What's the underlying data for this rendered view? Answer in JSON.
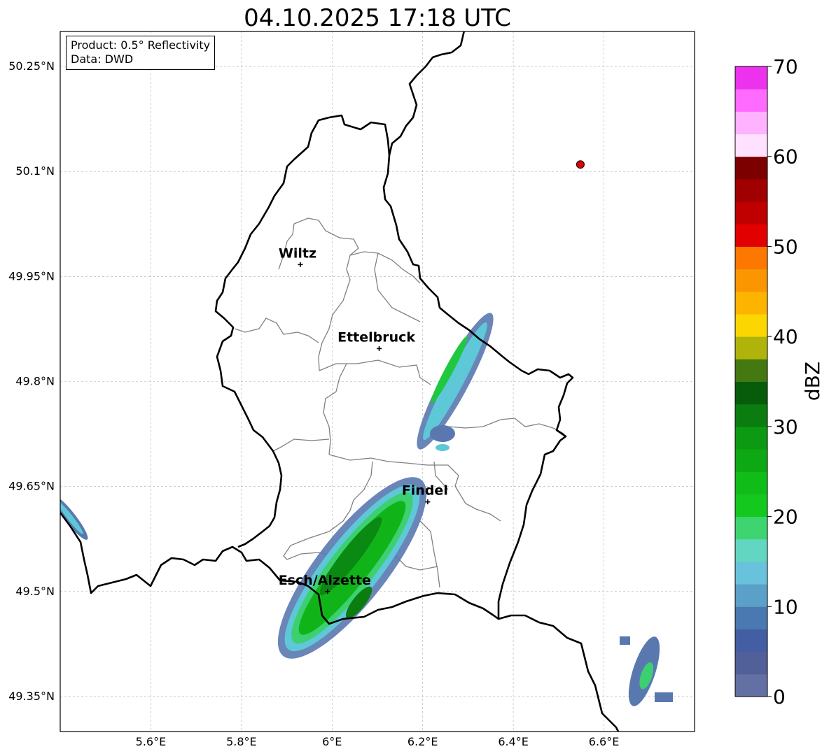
{
  "title": "04.10.2025 17:18 UTC",
  "info_box": {
    "product": "Product: 0.5° Reflectivity",
    "source": "Data: DWD"
  },
  "map": {
    "lon_range": [
      5.4,
      6.8
    ],
    "lat_range": [
      49.3,
      50.3
    ],
    "lon_ticks": [
      {
        "value": 5.6,
        "label": "5.6°E"
      },
      {
        "value": 5.8,
        "label": "5.8°E"
      },
      {
        "value": 6.0,
        "label": "6°E"
      },
      {
        "value": 6.2,
        "label": "6.2°E"
      },
      {
        "value": 6.4,
        "label": "6.4°E"
      },
      {
        "value": 6.6,
        "label": "6.6°E"
      }
    ],
    "lat_ticks": [
      {
        "value": 49.35,
        "label": "49.35°N"
      },
      {
        "value": 49.5,
        "label": "49.5°N"
      },
      {
        "value": 49.65,
        "label": "49.65°N"
      },
      {
        "value": 49.8,
        "label": "49.8°N"
      },
      {
        "value": 49.95,
        "label": "49.95°N"
      },
      {
        "value": 50.1,
        "label": "50.1°N"
      },
      {
        "value": 50.25,
        "label": "50.25°N"
      }
    ],
    "grid": true,
    "cities": [
      {
        "name": "Wiltz",
        "lon": 5.93,
        "lat": 49.967
      },
      {
        "name": "Ettelbruck",
        "lon": 6.104,
        "lat": 49.847
      },
      {
        "name": "Findel",
        "lon": 6.211,
        "lat": 49.628
      },
      {
        "name": "Esch/Alzette",
        "lon": 5.99,
        "lat": 49.5
      }
    ],
    "radar_site": {
      "lon": 6.548,
      "lat": 50.11,
      "color": "#e00000"
    }
  },
  "colorbar": {
    "label": "dBZ",
    "min": 0,
    "max": 70,
    "step": 2.5,
    "tick_values": [
      0,
      10,
      20,
      30,
      40,
      50,
      60,
      70
    ],
    "colors": [
      "#6270a4",
      "#526099",
      "#445ea3",
      "#4a78b0",
      "#5ba0c8",
      "#68c2dc",
      "#62d6c0",
      "#3ed470",
      "#14c81e",
      "#10bc18",
      "#0ea814",
      "#0c9a12",
      "#0a7c10",
      "#065c0a",
      "#447810",
      "#b0b40a",
      "#fcd600",
      "#fcb400",
      "#fc9600",
      "#fc7800",
      "#e20000",
      "#c00000",
      "#a00000",
      "#7c0000",
      "#ffe0ff",
      "#ffb2ff",
      "#ff6aff",
      "#ec32ec"
    ]
  }
}
